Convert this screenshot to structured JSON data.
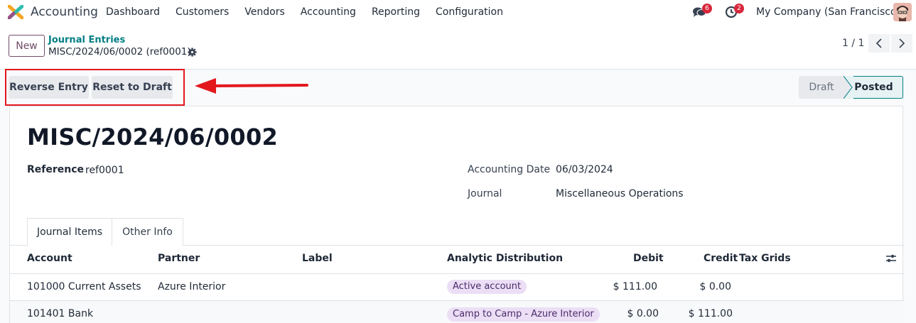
{
  "navbar": {
    "app_name": "Accounting",
    "menu": [
      "Dashboard",
      "Customers",
      "Vendors",
      "Accounting",
      "Reporting",
      "Configuration"
    ],
    "chat_badge": "6",
    "activity_badge": "2",
    "company": "My Company (San Francisco)"
  },
  "control": {
    "new_label": "New",
    "breadcrumb_parent": "Journal Entries",
    "breadcrumb_current": "MISC/2024/06/0002 (ref0001)",
    "pager": "1 / 1"
  },
  "actions": {
    "reverse": "Reverse Entry",
    "reset": "Reset to Draft"
  },
  "status": {
    "draft": "Draft",
    "posted": "Posted"
  },
  "form": {
    "title": "MISC/2024/06/0002",
    "reference_label": "Reference",
    "reference_value": "ref0001",
    "date_label": "Accounting Date",
    "date_value": "06/03/2024",
    "journal_label": "Journal",
    "journal_value": "Miscellaneous Operations"
  },
  "tabs": [
    "Journal Items",
    "Other Info"
  ],
  "table": {
    "headers": [
      "Account",
      "Partner",
      "Label",
      "Analytic Distribution",
      "Debit",
      "Credit",
      "Tax Grids"
    ],
    "rows": [
      {
        "account": "101000 Current Assets",
        "partner": "Azure Interior",
        "label": "",
        "analytic": "Active account",
        "debit": "$ 111.00",
        "credit": "$ 0.00"
      },
      {
        "account": "101401 Bank",
        "partner": "",
        "label": "",
        "analytic": "Camp to Camp - Azure Interior",
        "debit": "$ 0.00",
        "credit": "$ 111.00"
      }
    ]
  },
  "colors": {
    "brand": "#714b67",
    "teal": "#017e84",
    "highlight": "#e3181d"
  }
}
